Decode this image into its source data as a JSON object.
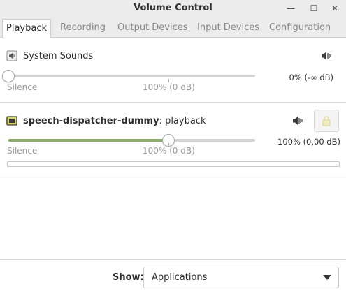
{
  "window": {
    "title": "Volume Control",
    "minimize_glyph": "—",
    "maximize_glyph": "☐",
    "close_glyph": "✕"
  },
  "tabs": [
    {
      "label": "Playback",
      "active": true
    },
    {
      "label": "Recording",
      "active": false
    },
    {
      "label": "Output Devices",
      "active": false
    },
    {
      "label": "Input Devices",
      "active": false
    },
    {
      "label": "Configuration",
      "active": false
    }
  ],
  "streams": [
    {
      "name": "System Sounds",
      "icon": "speaker-icon",
      "mute_icon": "speaker-mute-icon",
      "volume_percent": 0,
      "value_text": "0% (-∞ dB)",
      "mark_min": "Silence",
      "mark_ref": "100% (0 dB)"
    },
    {
      "app_name": "speech-dispatcher-dummy",
      "separator": ": ",
      "stream_name": "playback",
      "icon": "audio-card-icon",
      "mute_icon": "speaker-mute-icon",
      "lock_icon": "lock-icon",
      "volume_percent": 100,
      "value_text": "100% (0,00 dB)",
      "mark_min": "Silence",
      "mark_ref": "100% (0 dB)",
      "peak_level": 0
    }
  ],
  "footer": {
    "show_label": "Show:",
    "show_value": "Applications"
  },
  "colors": {
    "accent": "#8ab06a",
    "track": "#d3d3d3",
    "chrome": "#ececec"
  }
}
